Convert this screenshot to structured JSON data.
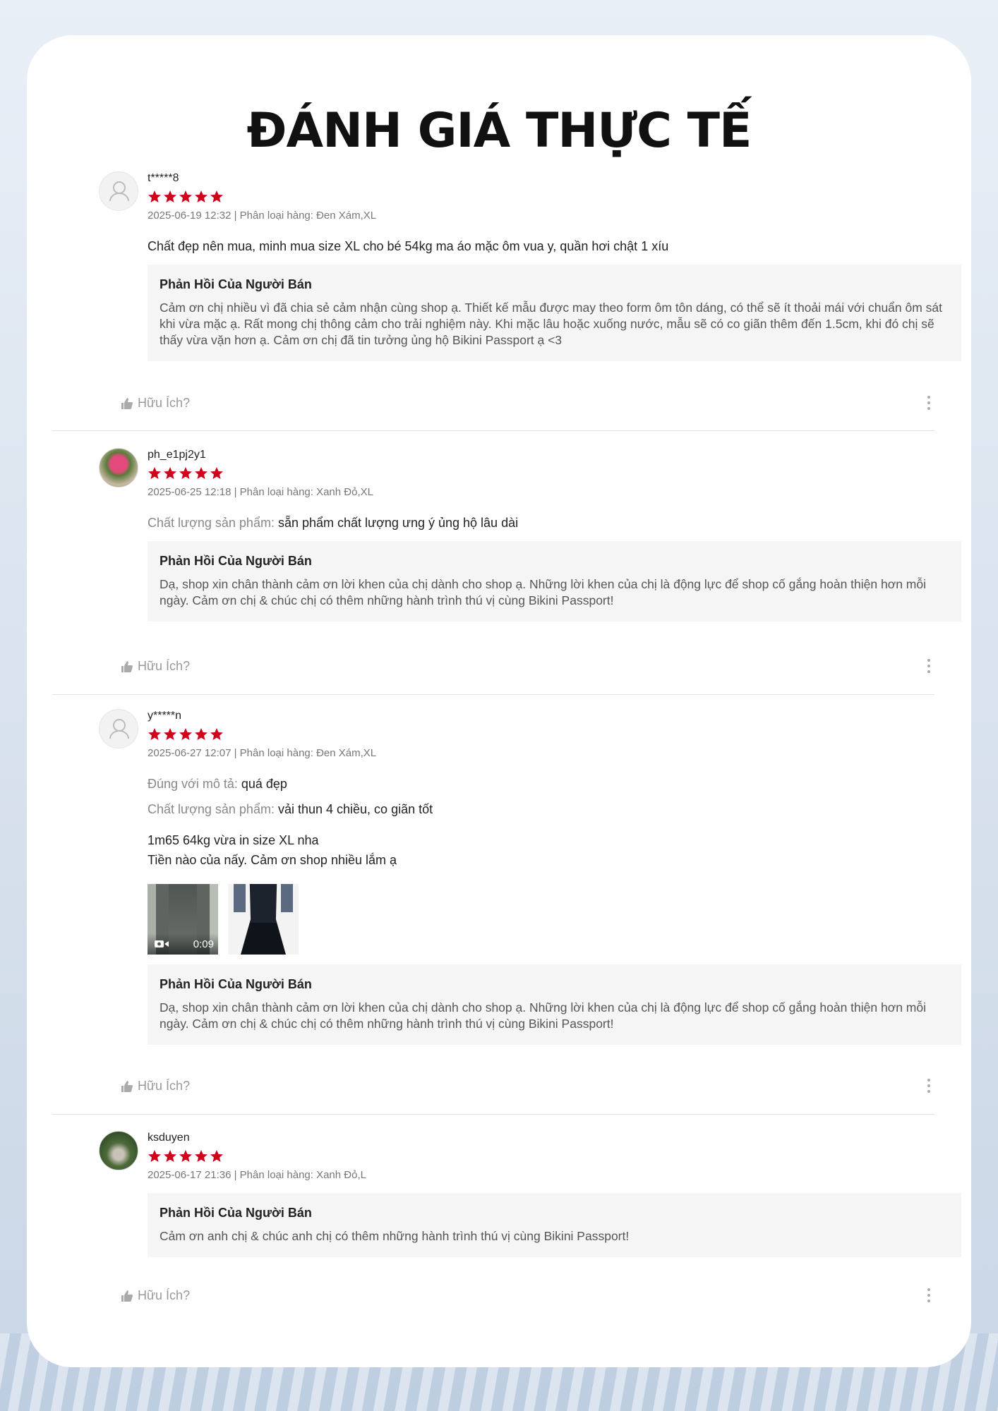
{
  "title": "ĐÁNH GIÁ THỰC TẾ",
  "colors": {
    "star": "#d0011b",
    "card_bg": "#ffffff",
    "reply_bg": "#f5f5f5"
  },
  "reviews": [
    {
      "username": "t*****8",
      "rating": 5,
      "meta": "2025-06-19 12:32 | Phân loại hàng: Đen Xám,XL",
      "comment": "Chất đẹp nên mua, minh mua size XL cho bé 54kg ma áo mặc ôm vua y, quần hơi chật 1 xíu",
      "reply_title": "Phản Hồi Của Người Bán",
      "reply_text": "Cảm ơn chị nhiều vì đã chia sẻ cảm nhận cùng shop ạ. Thiết kế mẫu được may theo form ôm tôn dáng, có thể sẽ ít thoải mái với chuẩn ôm sát khi vừa mặc ạ. Rất mong chị thông cảm cho trải nghiệm này. Khi mặc lâu hoặc xuống nước, mẫu sẽ có co giãn thêm đến 1.5cm, khi đó chị sẽ thấy vừa vặn hơn ạ. Cảm ơn chị đã tin tưởng ủng hộ Bikini Passport ạ <3",
      "helpful": "Hữu Ích?"
    },
    {
      "username": "ph_e1pj2y1",
      "rating": 5,
      "meta": "2025-06-25 12:18 | Phân loại hàng: Xanh Đỏ,XL",
      "attr_label": "Chất lượng sản phẩm:",
      "attr_value": "sẵn phẩm chất lượng ưng ý ủng hộ lâu dài",
      "reply_title": "Phản Hồi Của Người Bán",
      "reply_text": "Dạ, shop xin chân thành cảm ơn lời khen của chị dành cho shop ạ. Những lời khen của chị là động lực để shop cố gắng hoàn thiện hơn mỗi ngày. Cảm ơn chị & chúc chị có thêm những hành trình thú vị cùng Bikini Passport!",
      "helpful": "Hữu Ích?"
    },
    {
      "username": "y*****n",
      "rating": 5,
      "meta": "2025-06-27 12:07 | Phân loại hàng: Đen Xám,XL",
      "attr1_label": "Đúng với mô tả:",
      "attr1_value": "quá đẹp",
      "attr2_label": "Chất lượng sản phẩm:",
      "attr2_value": "vải thun 4 chiều, co giãn tốt",
      "comment_line1": "1m65 64kg vừa in size XL nha",
      "comment_line2": "Tiền nào của nấy. Cảm ơn shop nhiều lắm ạ",
      "video_duration": "0:09",
      "reply_title": "Phản Hồi Của Người Bán",
      "reply_text": "Dạ, shop xin chân thành cảm ơn lời khen của chị dành cho shop ạ. Những lời khen của chị là động lực để shop cố gắng hoàn thiện hơn mỗi ngày. Cảm ơn chị & chúc chị có thêm những hành trình thú vị cùng Bikini Passport!",
      "helpful": "Hữu Ích?"
    },
    {
      "username": "ksduyen",
      "rating": 5,
      "meta": "2025-06-17 21:36 | Phân loại hàng: Xanh Đỏ,L",
      "reply_title": "Phản Hồi Của Người Bán",
      "reply_text": "Cảm ơn anh chị & chúc anh chị có thêm những hành trình thú vị cùng Bikini Passport!",
      "helpful": "Hữu Ích?"
    }
  ]
}
